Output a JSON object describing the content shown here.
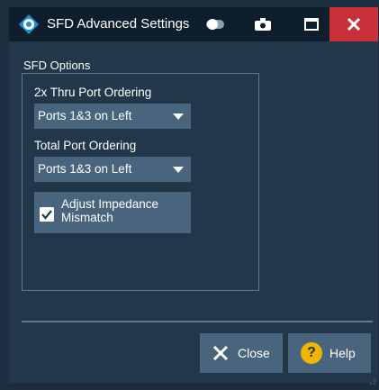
{
  "window": {
    "title": "SFD Advanced Settings"
  },
  "titlebar": {
    "icons": [
      "app-logo-icon",
      "toggle-icon",
      "camera-icon",
      "maximize-icon",
      "close-icon"
    ]
  },
  "group": {
    "label": "SFD Options",
    "thru_port_label": "2x Thru Port Ordering",
    "thru_port_value": "Ports 1&3 on Left",
    "total_port_label": "Total Port Ordering",
    "total_port_value": "Ports 1&3 on Left",
    "adjust_label": "Adjust Impedance Mismatch",
    "adjust_checked": true
  },
  "buttons": {
    "close_label": "Close",
    "help_label": "Help",
    "help_glyph": "?"
  },
  "colors": {
    "accent_close": "#c8303a",
    "help_yellow": "#f2b600"
  }
}
